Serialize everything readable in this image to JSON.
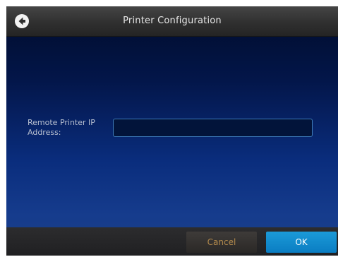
{
  "header": {
    "title": "Printer Configuration",
    "back_icon": "arrow-left-circle-icon"
  },
  "form": {
    "ip_label": "Remote Printer IP Address:",
    "ip_value": "",
    "ip_placeholder": ""
  },
  "footer": {
    "cancel_label": "Cancel",
    "ok_label": "OK"
  },
  "colors": {
    "ok_button": "#0a86c9",
    "cancel_text": "#b38a4c",
    "input_border": "#3c78b6",
    "background_dark": "#000c2a",
    "background_light": "#163c8d"
  }
}
